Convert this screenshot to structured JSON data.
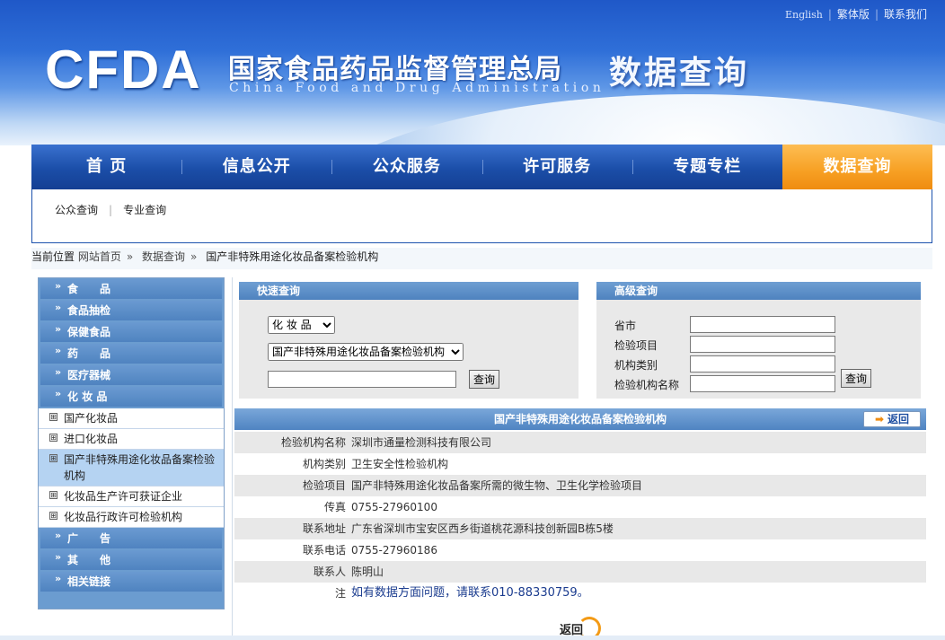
{
  "header": {
    "links": [
      "English",
      "繁体版",
      "联系我们"
    ],
    "logo": "CFDA",
    "title_cn": "国家食品药品监督管理总局",
    "title_en": "China Food and Drug Administration",
    "section_title": "数据查询"
  },
  "nav": {
    "items": [
      "首 页",
      "信息公开",
      "公众服务",
      "许可服务",
      "专题专栏",
      "数据查询"
    ],
    "active": "数据查询"
  },
  "subnav": [
    "公众查询",
    "专业查询"
  ],
  "breadcrumb": {
    "label": "当前位置",
    "items": [
      "网站首页",
      "数据查询",
      "国产非特殊用途化妆品备案检验机构"
    ]
  },
  "sidebar": {
    "categories_top": [
      "食　　品",
      "食品抽检",
      "保健食品",
      "药　　品",
      "医疗器械",
      "化 妆 品"
    ],
    "sub_items": [
      "国产化妆品",
      "进口化妆品",
      "国产非特殊用途化妆品备案检验机构",
      "化妆品生产许可获证企业",
      "化妆品行政许可检验机构"
    ],
    "categories_bottom": [
      "广　　告",
      "其　　他",
      "相关链接"
    ],
    "box_glyph": "⊞"
  },
  "quick_search": {
    "title": "快速查询",
    "select1": "化 妆 品",
    "select2": "国产非特殊用途化妆品备案检验机构",
    "input_value": "",
    "button": "查询"
  },
  "advanced_search": {
    "title": "高级查询",
    "fields": [
      "省市",
      "检验项目",
      "机构类别",
      "检验机构名称"
    ],
    "button": "查询"
  },
  "result": {
    "title": "国产非特殊用途化妆品备案检验机构",
    "back_label": "返回",
    "rows": [
      {
        "key": "检验机构名称",
        "value": "深圳市通量检测科技有限公司"
      },
      {
        "key": "机构类别",
        "value": "卫生安全性检验机构"
      },
      {
        "key": "检验项目",
        "value": "国产非特殊用途化妆品备案所需的微生物、卫生化学检验项目"
      },
      {
        "key": "传真",
        "value": "0755-27960100"
      },
      {
        "key": "联系地址",
        "value": "广东省深圳市宝安区西乡街道桃花源科技创新园B栋5楼"
      },
      {
        "key": "联系电话",
        "value": "0755-27960186"
      },
      {
        "key": "联系人",
        "value": "陈明山"
      },
      {
        "key": "注",
        "value": "如有数据方面问题，请联系010-88330759。"
      }
    ],
    "bottom_back": "返回"
  },
  "colors": {
    "nav_blue": "#1b4ea8",
    "nav_active": "#f7a023",
    "panel_blue": "#4e82bf"
  }
}
